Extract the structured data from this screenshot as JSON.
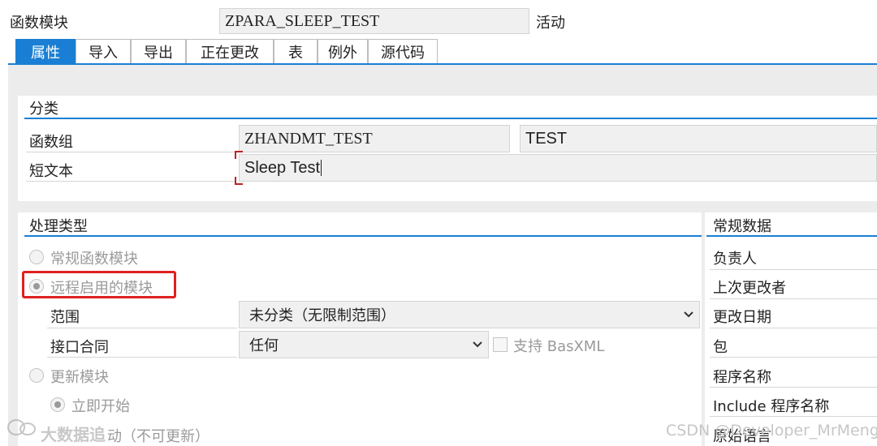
{
  "header": {
    "object_label": "函数模块",
    "object_value": "ZPARA_SLEEP_TEST",
    "status": "活动"
  },
  "tabs": [
    {
      "label": "属性",
      "active": true
    },
    {
      "label": "导入"
    },
    {
      "label": "导出"
    },
    {
      "label": "正在更改"
    },
    {
      "label": "表"
    },
    {
      "label": "例外"
    },
    {
      "label": "源代码"
    }
  ],
  "classification": {
    "title": "分类",
    "function_group_label": "函数组",
    "function_group_value": "ZHANDMT_TEST",
    "function_group_text": "TEST",
    "short_text_label": "短文本",
    "short_text_value": "Sleep Test"
  },
  "processing": {
    "title": "处理类型",
    "normal": "常规函数模块",
    "remote": "远程启用的模块",
    "scope_label": "范围",
    "scope_value": "未分类（无限制范围）",
    "interface_label": "接口合同",
    "interface_value": "任何",
    "basxml_label": "支持 BasXML",
    "update": "更新模块",
    "start_immediately": "立即开始",
    "start_delayed": "动（不可更新）"
  },
  "general": {
    "title": "常规数据",
    "fields": [
      "负责人",
      "上次更改者",
      "更改日期",
      "包",
      "程序名称",
      "Include 程序名称",
      "原始语言"
    ]
  },
  "watermark": {
    "left": "大数据追",
    "right": "CSDN @Developer_MrMeng"
  },
  "colors": {
    "accent": "#1a7fd4",
    "highlight_box": "#e02020"
  }
}
